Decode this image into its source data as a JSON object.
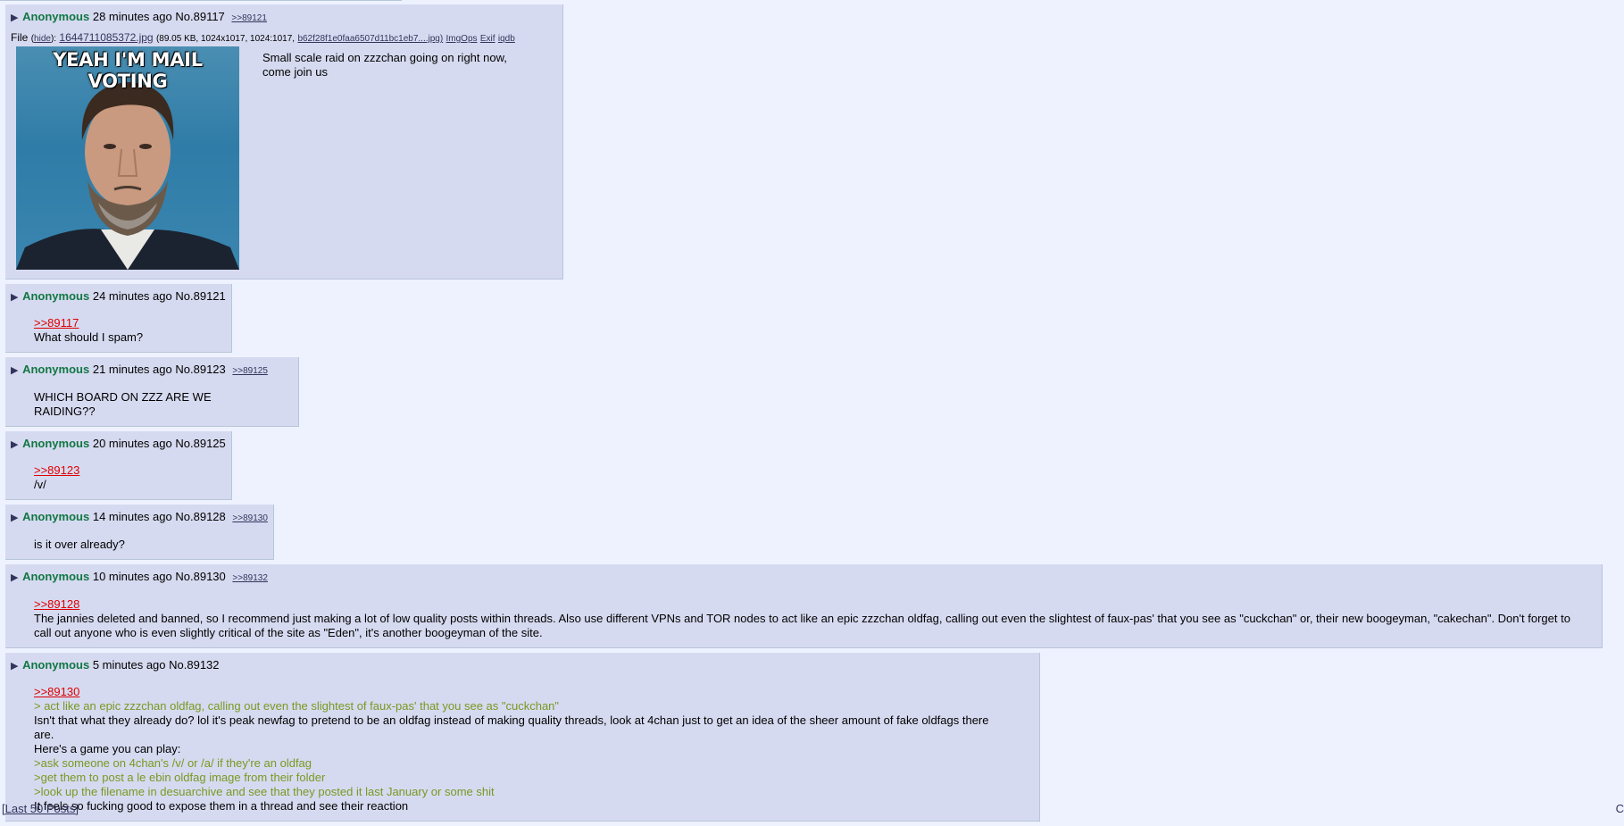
{
  "op": {
    "name": "Anonymous",
    "time": "28 minutes ago",
    "no": "No.89117",
    "backlinks": [
      ">>89121"
    ],
    "file": {
      "label": "File",
      "hide": "hide",
      "filename": "1644711085372.jpg",
      "meta": "(89.05 KB, 1024x1017, 1024:1017,",
      "hash": "b62f28f1e0faa6507d11bc1eb7....jpg)",
      "links": [
        "ImgOps",
        "Exif",
        "iqdb"
      ],
      "thumb_caption": "YEAH I'M MAIL VOTING"
    },
    "message": [
      "Small scale raid on zzzchan going on right now,",
      "come join us"
    ]
  },
  "replies": [
    {
      "name": "Anonymous",
      "time": "24 minutes ago",
      "no": "No.89121",
      "backlinks": [],
      "lines": [
        {
          "type": "quote",
          "text": ">>89117"
        },
        {
          "type": "text",
          "text": "What should I spam?"
        }
      ]
    },
    {
      "name": "Anonymous",
      "time": "21 minutes ago",
      "no": "No.89123",
      "backlinks": [
        ">>89125"
      ],
      "lines": [
        {
          "type": "text",
          "text": "WHICH BOARD ON ZZZ ARE WE RAIDING??"
        }
      ]
    },
    {
      "name": "Anonymous",
      "time": "20 minutes ago",
      "no": "No.89125",
      "backlinks": [],
      "lines": [
        {
          "type": "quote",
          "text": ">>89123"
        },
        {
          "type": "text",
          "text": "/v/"
        }
      ]
    },
    {
      "name": "Anonymous",
      "time": "14 minutes ago",
      "no": "No.89128",
      "backlinks": [
        ">>89130"
      ],
      "lines": [
        {
          "type": "text",
          "text": "is it over already?"
        }
      ]
    },
    {
      "name": "Anonymous",
      "time": "10 minutes ago",
      "no": "No.89130",
      "backlinks": [
        ">>89132"
      ],
      "lines": [
        {
          "type": "quote",
          "text": ">>89128"
        },
        {
          "type": "text",
          "text": "The jannies deleted and banned, so I recommend just making a lot of low quality posts within threads. Also use different VPNs and TOR nodes to act like an epic zzzchan oldfag, calling out even the slightest of faux-pas' that you see as \"cuckchan\" or, their new boogeyman, \"cakechan\". Don't forget to call out anyone who is even slightly critical of the site as \"Eden\", it's another boogeyman of the site."
        }
      ]
    },
    {
      "name": "Anonymous",
      "time": "5 minutes ago",
      "no": "No.89132",
      "backlinks": [],
      "lines": [
        {
          "type": "quote",
          "text": ">>89130"
        },
        {
          "type": "green",
          "text": "> act like an epic zzzchan oldfag, calling out even the slightest of faux-pas' that you see as \"cuckchan\""
        },
        {
          "type": "text",
          "text": "Isn't that what they already do? lol it's peak newfag to pretend to be an oldfag instead of making quality threads, look at 4chan just to get an idea of the sheer amount of fake oldfags there are."
        },
        {
          "type": "text",
          "text": "Here's a game you can play:"
        },
        {
          "type": "green",
          "text": ">ask someone on 4chan's /v/ or /a/ if they're an oldfag"
        },
        {
          "type": "green",
          "text": ">get them to post a le ebin oldfag image from their folder"
        },
        {
          "type": "green",
          "text": ">look up the filename in desuarchive and see that they posted it last January or some shit"
        },
        {
          "type": "text",
          "text": "It feels so fucking good to expose them in a thread and see their reaction"
        }
      ]
    }
  ],
  "footer": {
    "last50": "[Last 50 Posts]",
    "edge": "C"
  },
  "colors": {
    "bg": "#eef2ff",
    "post_bg": "#d6daf0",
    "name": "#117743",
    "quote": "#dd0000",
    "greentext": "#789922"
  }
}
